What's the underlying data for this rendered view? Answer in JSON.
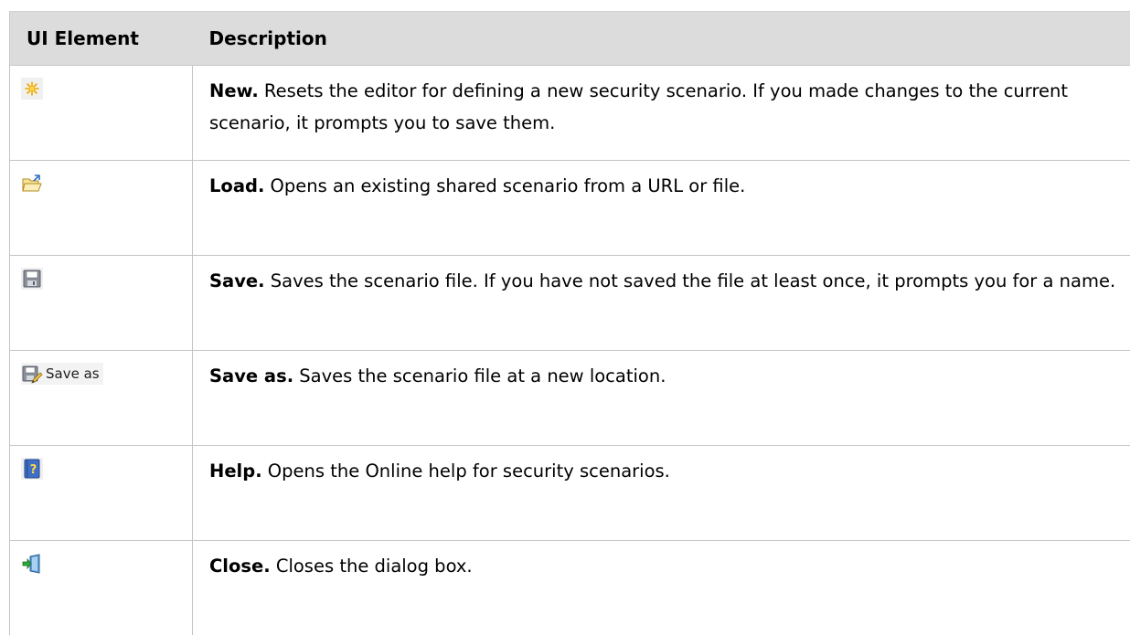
{
  "table": {
    "headers": {
      "ui_element": "UI Element",
      "description": "Description"
    },
    "rows": [
      {
        "icon": "new-icon",
        "name": "New.",
        "text": " Resets the editor for defining a new security scenario. If you made changes to the current scenario, it prompts you to save them."
      },
      {
        "icon": "load-folder-icon",
        "name": "Load.",
        "text": " Opens an existing shared scenario from a URL or file."
      },
      {
        "icon": "save-floppy-icon",
        "name": "Save.",
        "text": " Saves the scenario file. If you have not saved the file at least once, it prompts you for a name."
      },
      {
        "icon": "save-as-icon",
        "icon_label": "Save as",
        "name": "Save as.",
        "text": " Saves the scenario file at a new location."
      },
      {
        "icon": "help-book-icon",
        "name": "Help.",
        "text": " Opens the Online help for security scenarios."
      },
      {
        "icon": "close-exit-icon",
        "name": "Close.",
        "text": " Closes the dialog box."
      }
    ]
  },
  "colors": {
    "header_bg": "#dcdcdc",
    "border": "#c4c4c4"
  }
}
